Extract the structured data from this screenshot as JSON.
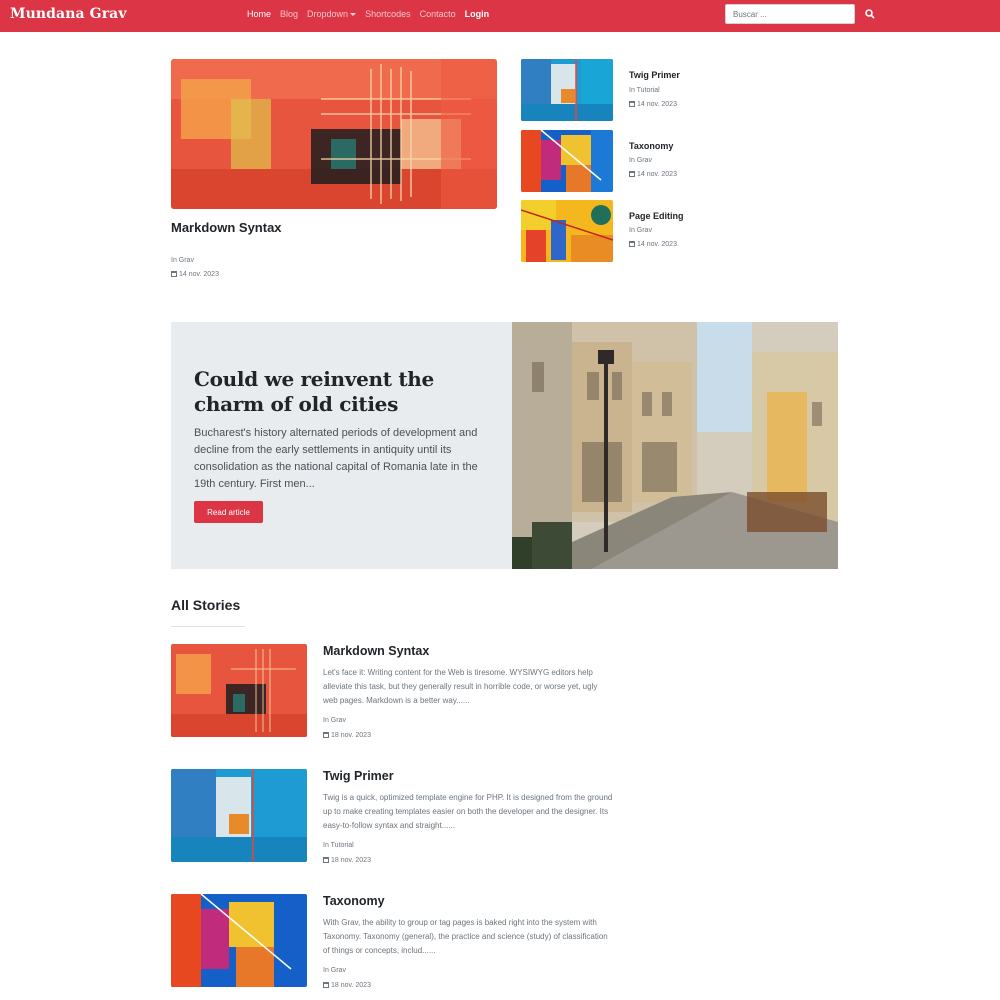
{
  "navbar": {
    "brand": "Mundana Grav",
    "links": [
      "Home",
      "Blog",
      "Dropdown",
      "Shortcodes",
      "Contacto",
      "Login"
    ],
    "search_placeholder": "Buscar ...",
    "accent": "#dc3545"
  },
  "featured": {
    "main": {
      "title": "Markdown Syntax",
      "category": "In Grav",
      "date": "14 nov. 2023"
    },
    "side": [
      {
        "title": "Twig Primer",
        "category": "In Tutorial",
        "date": "14 nov. 2023"
      },
      {
        "title": "Taxonomy",
        "category": "In Grav",
        "date": "14 nov. 2023"
      },
      {
        "title": "Page Editing",
        "category": "In Grav",
        "date": "14 nov. 2023"
      }
    ]
  },
  "hero": {
    "title": "Could we reinvent the charm of old cities",
    "text": "Bucharest's history alternated periods of development and decline from the early settlements in antiquity until its consolidation as the national capital of Romania late in the 19th century. First men...",
    "button": "Read article"
  },
  "stories": {
    "heading": "All Stories",
    "items": [
      {
        "title": "Markdown Syntax",
        "excerpt": "Let's face it: Writing content for the Web is tiresome. WYSIWYG editors help alleviate this task, but they generally result in horrible code, or worse yet, ugly web pages. Markdown is a better way......",
        "category": "In Grav",
        "date": "18 nov. 2023"
      },
      {
        "title": "Twig Primer",
        "excerpt": "Twig is a quick, optimized template engine for PHP. It is designed from the ground up to make creating templates easier on both the developer and the designer. Its easy-to-follow syntax and straight......",
        "category": "In Tutorial",
        "date": "18 nov. 2023"
      },
      {
        "title": "Taxonomy",
        "excerpt": "With Grav, the ability to group or tag pages is baked right into the system with Taxonomy. Taxonomy (general), the practice and science (study) of classification of things or concepts, includ......",
        "category": "In Grav",
        "date": "18 nov. 2023"
      }
    ]
  }
}
